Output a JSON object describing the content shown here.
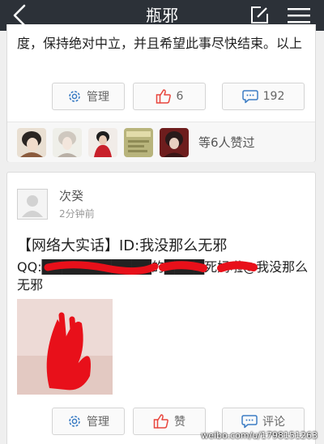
{
  "nav": {
    "title": "瓶邪",
    "icons": {
      "back": "back-arrow-icon",
      "compose": "compose-icon",
      "menu": "hamburger-menu-icon"
    }
  },
  "posts": [
    {
      "text": "度，保持绝对中立，并且希望此事尽快结束。以上",
      "actions": {
        "manage_label": "管理",
        "like_count": "6",
        "comment_count": "192"
      },
      "likers": {
        "summary": "等6人赞过"
      }
    },
    {
      "author": "次癸",
      "time": "2分钟前",
      "title": "【网络大实话】ID:我没那么无邪",
      "text": "QQ:███████████的████死妈啦@我没那么无邪",
      "actions": {
        "manage_label": "管理",
        "like_label": "赞",
        "comment_label": "评论"
      }
    }
  ],
  "watermark": "weibo.com/u/1798151263",
  "colors": {
    "navbar": "#2c3138",
    "like_red": "#e8453c",
    "redaction": "#e8101a"
  }
}
